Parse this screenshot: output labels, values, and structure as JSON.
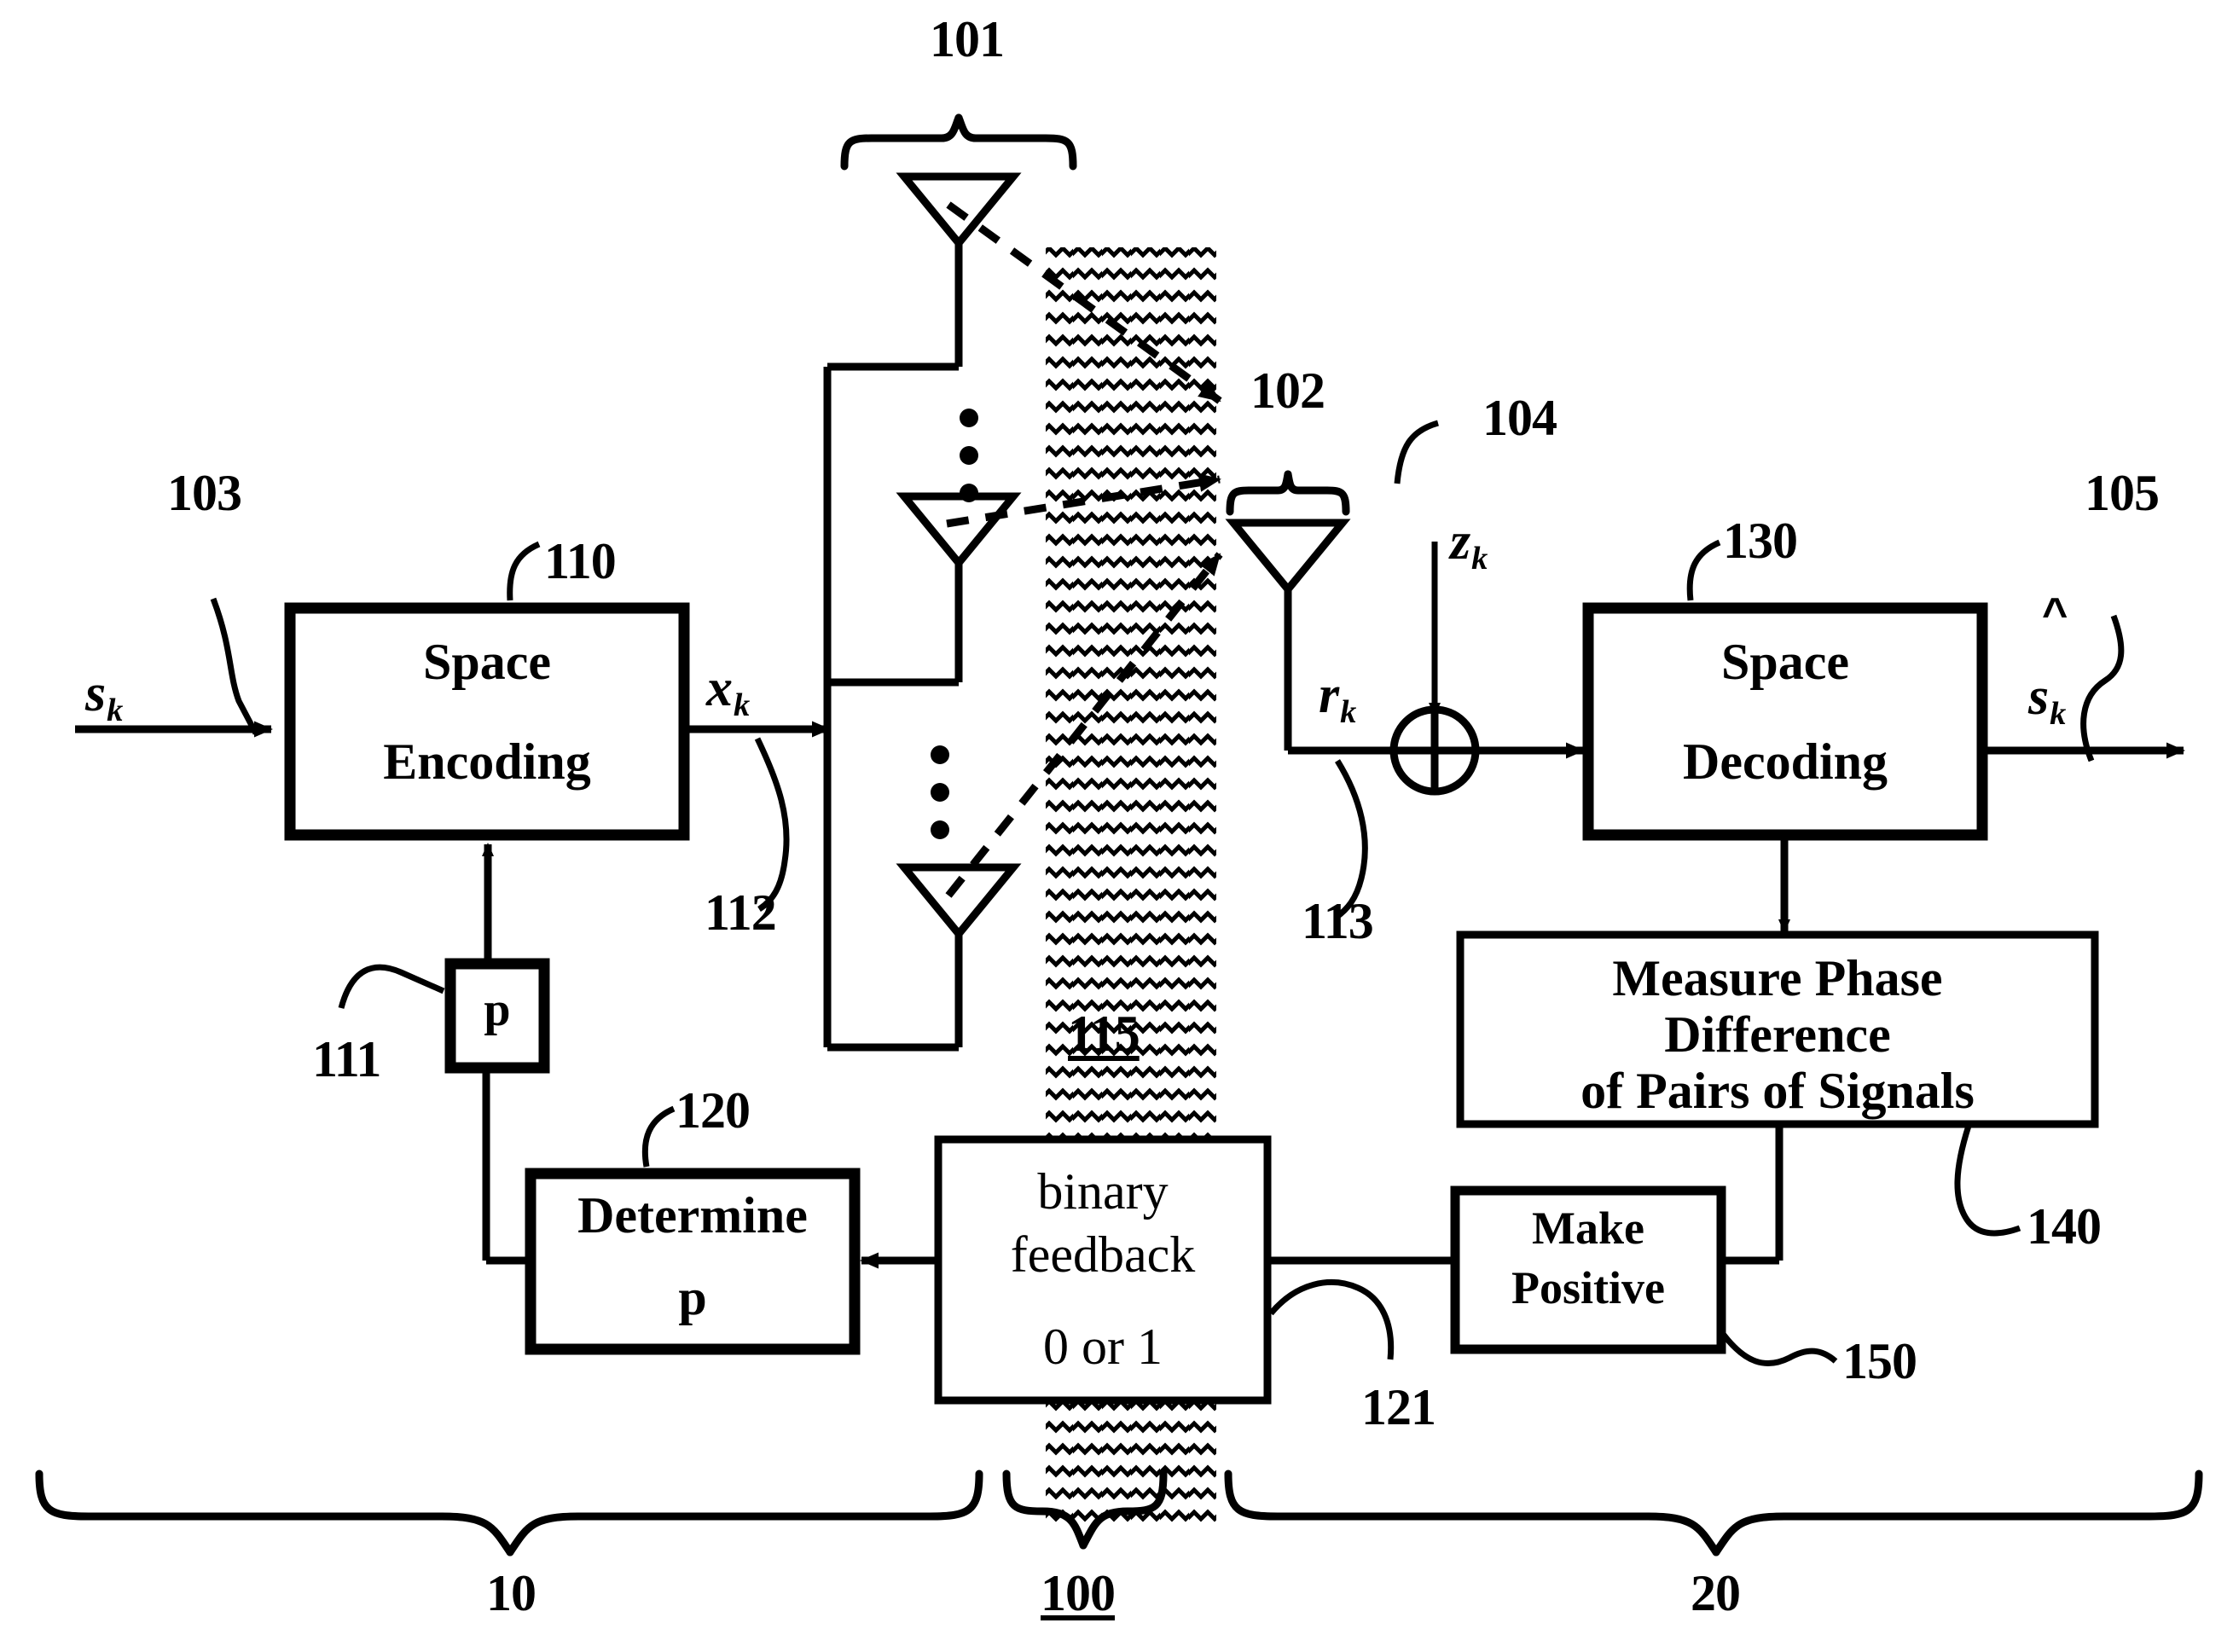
{
  "figure": {
    "type": "patent-block-diagram",
    "title": "MIMO transmit/receive block diagram with binary phase feedback"
  },
  "blocks": {
    "space_encoding": {
      "line1": "Space",
      "line2": "Encoding",
      "ref": "110"
    },
    "space_decoding": {
      "line1": "Space",
      "line2": "Decoding",
      "ref": "130"
    },
    "p_register": {
      "label": "p",
      "ref": "111"
    },
    "determine_p": {
      "line1": "Determine",
      "line2": "p",
      "ref": "120"
    },
    "measure_phase": {
      "line1": "Measure Phase",
      "line2": "Difference",
      "line3": "of Pairs of Signals",
      "ref": "140"
    },
    "make_positive": {
      "line1": "Make",
      "line2": "Positive",
      "ref": "150"
    },
    "binary_feedback": {
      "line1": "binary",
      "line2": "feedback",
      "line3": "0 or 1",
      "ref": "121"
    }
  },
  "signals": {
    "input": {
      "base": "s",
      "sub": "k",
      "ref": "103"
    },
    "encoded": {
      "base": "x",
      "sub": "k",
      "ref": "112"
    },
    "received": {
      "base": "r",
      "sub": "k",
      "ref": "113"
    },
    "noise": {
      "base": "z",
      "sub": "k",
      "ref": "104"
    },
    "output": {
      "base": "s",
      "sub": "k",
      "hat": "^",
      "ref": "105"
    }
  },
  "antennas": {
    "transmit_array": {
      "ref": "101",
      "count_shown": 3,
      "ellipsis": "⋮"
    },
    "receive_array": {
      "ref": "102",
      "count_shown": 1
    }
  },
  "channel": {
    "ref": "115",
    "style": "zigzag-hatch"
  },
  "braces": {
    "transmitter": {
      "ref": "10"
    },
    "system": {
      "ref": "100"
    },
    "receiver": {
      "ref": "20"
    }
  },
  "refs": {
    "r101": "101",
    "r102": "102",
    "r103": "103",
    "r104": "104",
    "r105": "105",
    "r110": "110",
    "r111": "111",
    "r112": "112",
    "r113": "113",
    "r115": "115",
    "r120": "120",
    "r121": "121",
    "r130": "130",
    "r140": "140",
    "r150": "150",
    "r10": "10",
    "r20": "20",
    "r100": "100"
  },
  "colors": {
    "stroke": "#000000",
    "background": "#ffffff"
  }
}
